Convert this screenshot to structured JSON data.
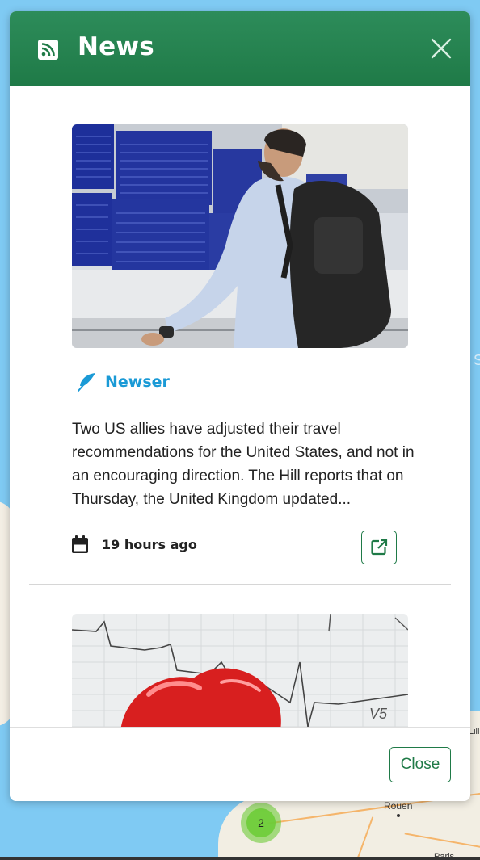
{
  "colors": {
    "header": "#1f7a47",
    "accent": "#1a9ad6",
    "map_water": "#7fcaf3",
    "cluster": "#6ecc39"
  },
  "map": {
    "labels": {
      "rouen": "Rouen",
      "lille": "Lille",
      "paris": "Paris",
      "edge": "S"
    },
    "cluster_count": "2"
  },
  "modal": {
    "title": "News",
    "title_icon": "rss-icon",
    "close_icon": "close-icon",
    "articles": [
      {
        "image": "traveler-airport-departures-board",
        "source_icon": "feather-icon",
        "source": "Newser",
        "text": "Two US allies have adjusted their travel recommendations for the United States, and not in an encouraging direction. The Hill reports that on Thursday, the United Kingdom updated...",
        "date_icon": "calendar-icon",
        "date": "19 hours ago",
        "link_icon": "external-link-icon"
      },
      {
        "image": "red-heart-on-ecg-chart"
      }
    ],
    "footer": {
      "close_label": "Close"
    }
  }
}
